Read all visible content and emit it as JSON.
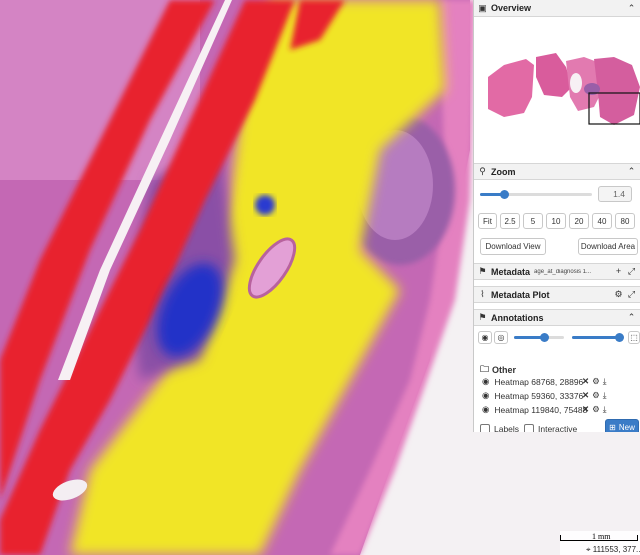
{
  "overview": {
    "title": "Overview"
  },
  "zoom": {
    "title": "Zoom",
    "value": "1.4",
    "level": 0.22,
    "presets": [
      "Fit",
      "2.5",
      "5",
      "10",
      "20",
      "40",
      "80"
    ],
    "download_view": "Download View",
    "download_area": "Download Area"
  },
  "metadata": {
    "title": "Metadata",
    "field": "age_at_diagnosis 1..."
  },
  "metadata_plot": {
    "title": "Metadata Plot"
  },
  "annotations": {
    "title": "Annotations",
    "opacity_1": 0.6,
    "opacity_2": 0.95,
    "group": "Other",
    "items": [
      {
        "label": "Heatmap 68768, 28896"
      },
      {
        "label": "Heatmap 59360, 33376"
      },
      {
        "label": "Heatmap 119840, 75488"
      }
    ],
    "labels_checkbox": "Labels",
    "interactive_checkbox": "Interactive",
    "new_button": "New"
  },
  "scale": {
    "label": "1 mm",
    "coords": "111553, 377..."
  },
  "colors": {
    "accent": "#3a7cc7",
    "heat_red": "#e8232e",
    "heat_yellow": "#f1e526",
    "heat_blue": "#2230c8",
    "tissue_pink": "#d76fb2"
  },
  "icons": [
    "image-icon",
    "search-icon",
    "tag-icon",
    "chart-icon",
    "caret-up-icon",
    "plus-icon",
    "expand-icon",
    "gear-icon",
    "eye-icon",
    "folder-icon",
    "close-icon",
    "download-icon",
    "pin-icon"
  ]
}
